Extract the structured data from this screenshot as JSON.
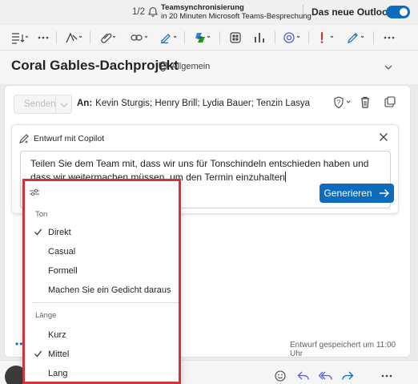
{
  "topbar": {
    "counter": "1/2",
    "notification_title": "Teamsynchronisierung",
    "notification_subtitle": "in 20 Minuten Microsoft Teams-Besprechung",
    "new_outlook_label": "Das neue Outlook",
    "new_outlook_enabled": true
  },
  "ribbon": {
    "icons": [
      "format-text-icon",
      "more-icon",
      "draw-icon",
      "attach-icon",
      "link-icon",
      "signature-icon",
      "copilot-icon",
      "apps-icon",
      "chart-icon",
      "loop-icon",
      "importance-icon",
      "sensitivity-icon",
      "more-icon"
    ]
  },
  "subject": {
    "title": "Coral Gables-Dachprojekt",
    "sensitivity_label": "Allgemein"
  },
  "compose": {
    "send_label": "Senden",
    "to_label": "An:",
    "recipients": "Kevin Sturgis; Henry Brill; Lydia Bauer; Tenzin Lasya",
    "draft_saved": "Entwurf gespeichert um 11:00 Uhr"
  },
  "copilot": {
    "title": "Entwurf mit Copilot",
    "prompt": "Teilen Sie dem Team mit, dass wir uns für Tonschindeln entschieden haben und dass wir weitermachen müssen, um den Termin einzuhalten",
    "generate_label": "Generieren"
  },
  "menu": {
    "tone_header": "Ton",
    "tone_options": [
      {
        "label": "Direkt",
        "selected": true
      },
      {
        "label": "Casual",
        "selected": false
      },
      {
        "label": "Formell",
        "selected": false
      },
      {
        "label": "Machen Sie ein Gedicht daraus",
        "selected": false
      }
    ],
    "length_header": "Länge",
    "length_options": [
      {
        "label": "Kurz",
        "selected": false
      },
      {
        "label": "Mittel",
        "selected": true
      },
      {
        "label": "Lang",
        "selected": false
      }
    ]
  },
  "colors": {
    "accent": "#0f6cbd",
    "highlight_border": "#d13438"
  }
}
